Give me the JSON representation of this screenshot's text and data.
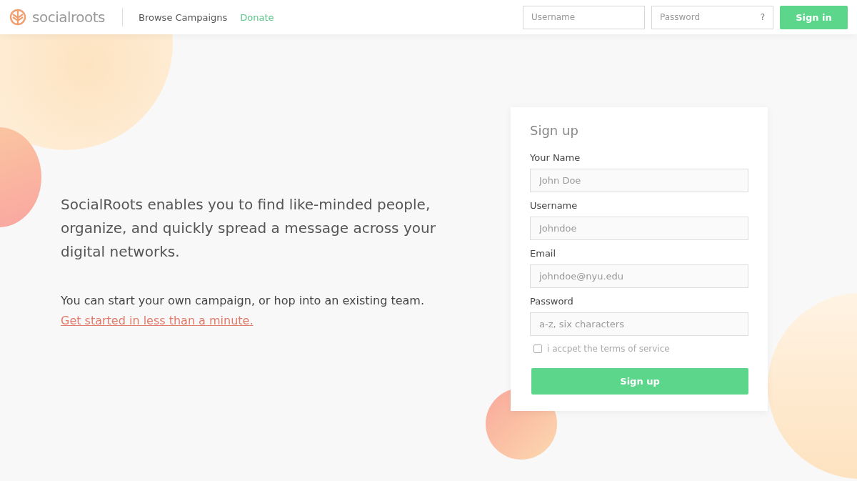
{
  "header": {
    "logo": "socialroots",
    "nav": [
      {
        "label": "Browse Campaigns",
        "selected": false
      },
      {
        "label": "Donate",
        "selected": true
      }
    ],
    "login": {
      "username_placeholder": "Username",
      "password_placeholder": "Password",
      "help": "?",
      "button": "Sign in"
    }
  },
  "hero": {
    "lead": "SocialRoots enables you to find like-minded people, organize, and quickly spread a message across your digital networks.",
    "body": "You can start your own campaign, or hop into an existing team.",
    "link": "Get started in less than a minute."
  },
  "signup": {
    "title": "Sign up",
    "fields": [
      {
        "label": "Your Name",
        "placeholder": "John Doe"
      },
      {
        "label": "Username",
        "placeholder": "Johndoe"
      },
      {
        "label": "Email",
        "placeholder": "johndoe@nyu.edu"
      },
      {
        "label": "Password",
        "placeholder": "a-z, six characters"
      }
    ],
    "terms": {
      "label": "i accpet the terms of service",
      "checked": false
    },
    "button": "Sign up"
  }
}
